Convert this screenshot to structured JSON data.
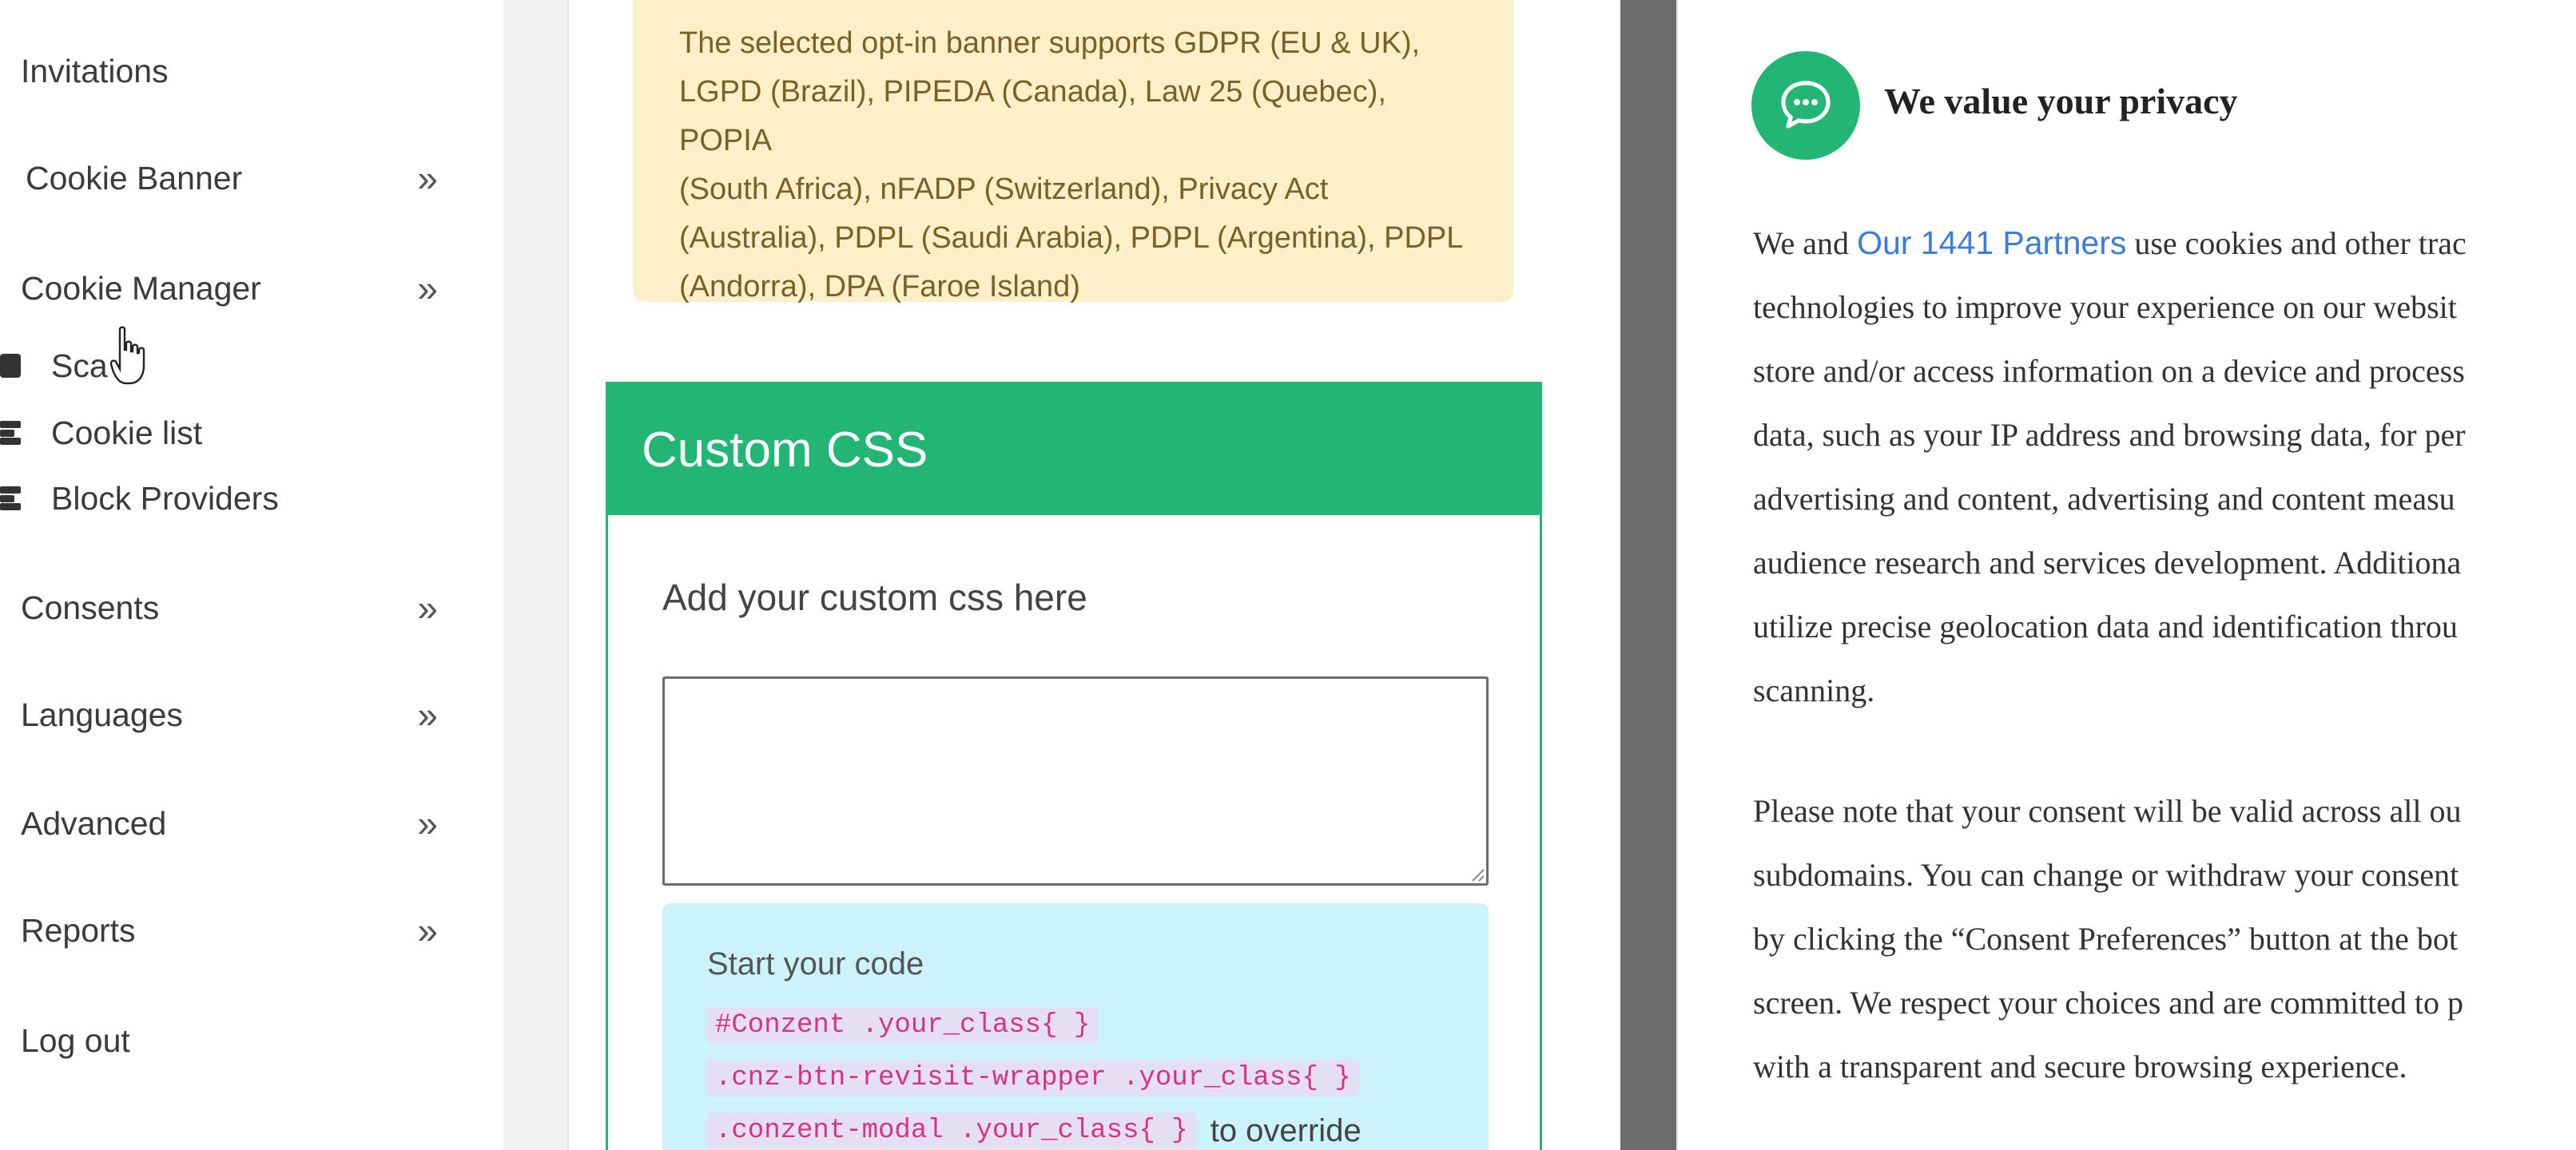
{
  "sidebar": {
    "items": [
      {
        "label": "Invitations",
        "chevron": ""
      },
      {
        "label": "Cookie Banner",
        "chevron": "»"
      },
      {
        "label": "Cookie Manager",
        "chevron": "»"
      },
      {
        "label": "Consents",
        "chevron": "»"
      },
      {
        "label": "Languages",
        "chevron": "»"
      },
      {
        "label": "Advanced",
        "chevron": "»"
      },
      {
        "label": "Reports",
        "chevron": "»"
      },
      {
        "label": "Log out",
        "chevron": ""
      }
    ],
    "subitems": [
      {
        "label": "Sca",
        "icon": "scan-icon"
      },
      {
        "label": "Cookie list",
        "icon": "list-icon"
      },
      {
        "label": "Block Providers",
        "icon": "block-icon"
      }
    ]
  },
  "notice": {
    "lines": [
      "The selected opt-in banner supports GDPR (EU & UK),",
      "LGPD (Brazil), PIPEDA (Canada), Law 25 (Quebec), POPIA",
      "(South Africa), nFADP (Switzerland), Privacy Act",
      "(Australia), PDPL (Saudi Arabia), PDPL (Argentina), PDPL",
      "(Andorra), DPA (Faroe Island)"
    ]
  },
  "custom_css": {
    "title": "Custom CSS",
    "label": "Add your custom css here",
    "textarea_value": "",
    "hint_title": "Start your code",
    "code_lines": [
      {
        "code": "#Conzent .your_class{ }",
        "after": ""
      },
      {
        "code": ".cnz-btn-revisit-wrapper .your_class{ }",
        "after": ""
      },
      {
        "code": ".conzent-modal .your_class{ }",
        "after": "to override"
      }
    ]
  },
  "preview": {
    "icon": "chat-bubble-icon",
    "title": "We value your privacy",
    "para1_prefix": "We and ",
    "para1_link": "Our 1441 Partners",
    "para1_suffix": " use cookies and other trac",
    "para1_lines": [
      "technologies to improve your experience on our websit",
      "store and/or access information on a device and process",
      "data, such as your IP address and browsing data, for per",
      "advertising and content, advertising and content measu",
      "audience research and services development. Additiona",
      "utilize precise geolocation data and identification throu",
      "scanning."
    ],
    "para2_lines": [
      "Please note that your consent will be valid across all ou",
      "subdomains. You can change or withdraw your consent",
      "by clicking the “Consent Preferences” button at the bot",
      "screen. We respect your choices and are committed to p",
      "with a transparent and secure browsing experience."
    ]
  },
  "colors": {
    "accent_green": "#22b573",
    "notice_bg": "#fdefc7",
    "hint_bg": "#ccf2fa",
    "link_blue": "#3b7ddd"
  }
}
